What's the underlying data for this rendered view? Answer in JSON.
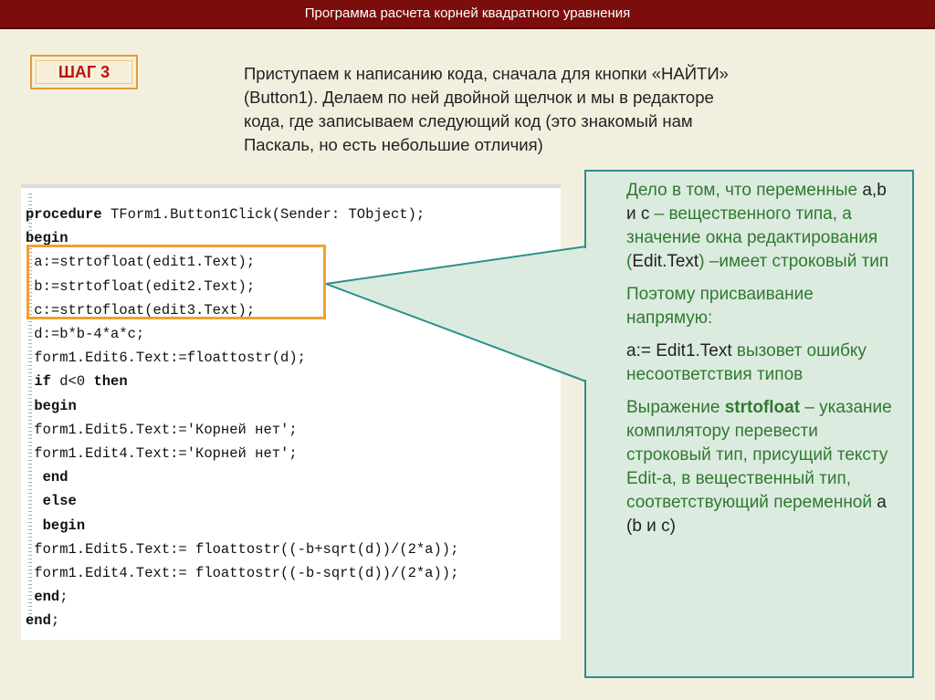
{
  "header": {
    "title": "Программа расчета корней квадратного уравнения"
  },
  "step": {
    "label": "ШАГ 3"
  },
  "intro": {
    "lines": [
      "Приступаем к написанию кода, сначала для кнопки «НАЙТИ»",
      "(Button1). Делаем по ней двойной щелчок и мы в редакторе",
      "кода, где записываем следующий код (это знакомый нам",
      "Паскаль, но есть небольшие отличия)"
    ]
  },
  "code": {
    "lines": [
      {
        "text": "procedure TForm1.Button1Click(Sender: TObject);",
        "kw": "procedure"
      },
      {
        "text": "begin",
        "kw": "begin"
      },
      {
        "text": " a:=strtofloat(edit1.Text);"
      },
      {
        "text": " b:=strtofloat(edit2.Text);"
      },
      {
        "text": " c:=strtofloat(edit3.Text);"
      },
      {
        "text": " d:=b*b-4*a*c;"
      },
      {
        "text": " form1.Edit6.Text:=floattostr(d);"
      },
      {
        "text": " if d<0 then",
        "kw": "if"
      },
      {
        "text": " begin",
        "kw": "begin"
      },
      {
        "text": " form1.Edit5.Text:='Корней нет';"
      },
      {
        "text": " form1.Edit4.Text:='Корней нет';"
      },
      {
        "text": "  end",
        "kw": "end"
      },
      {
        "text": "  else",
        "kw": "else"
      },
      {
        "text": "  begin",
        "kw": "begin"
      },
      {
        "text": " form1.Edit5.Text:= floattostr((-b+sqrt(d))/(2*a));"
      },
      {
        "text": " form1.Edit4.Text:= floattostr((-b-sqrt(d))/(2*a));"
      },
      {
        "text": " end;",
        "kw": "end"
      },
      {
        "text": "end;",
        "kw": "end"
      }
    ]
  },
  "callout": {
    "p1": {
      "a": " Дело в том, что переменные ",
      "b": "a,b и c",
      "c": " – вещественного типа, а значение окна редактирования (",
      "d": "Edit.Text",
      "e": ") –имеет строковый тип"
    },
    "p2": " Поэтому присваивание напрямую:",
    "p3": {
      "a": "a:= Edit1.Text",
      "b": " вызовет ошибку несоответствия типов"
    },
    "p4": {
      "a": "  Выражение ",
      "b": "strtofloat",
      "c": " – указание компилятору перевести строковый тип, присущий тексту Edit-а, в вещественный тип, соответствующий переменной ",
      "d": "a (b и c)"
    }
  },
  "colors": {
    "header_bg": "#7b0d0d",
    "step_text": "#c0110f",
    "highlight_border": "#f0a030",
    "callout_border": "#2e8f8a",
    "callout_bg": "#dcebe0"
  }
}
